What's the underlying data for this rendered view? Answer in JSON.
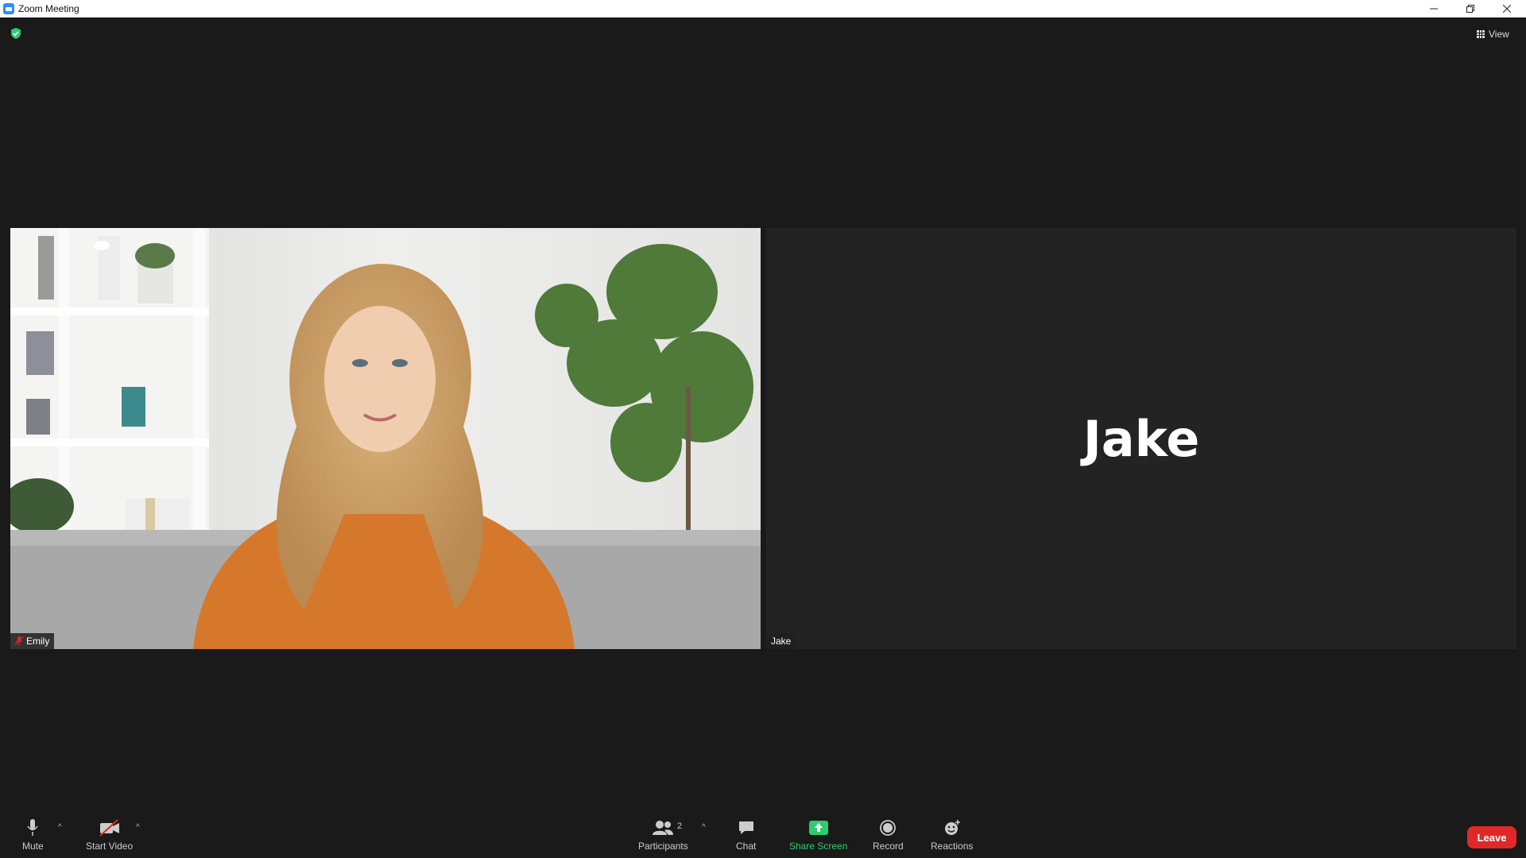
{
  "window": {
    "title": "Zoom Meeting"
  },
  "header": {
    "view_label": "View"
  },
  "participants": [
    {
      "name": "Emily",
      "muted": true,
      "video_on": true
    },
    {
      "name": "Jake",
      "muted": false,
      "video_on": false,
      "display_text": "Jake"
    }
  ],
  "toolbar": {
    "mute_label": "Mute",
    "start_video_label": "Start Video",
    "participants_label": "Participants",
    "participants_count": "2",
    "chat_label": "Chat",
    "share_label": "Share Screen",
    "record_label": "Record",
    "reactions_label": "Reactions",
    "leave_label": "Leave"
  },
  "colors": {
    "share_green": "#2ecc71",
    "leave_red": "#e02828",
    "shield_green": "#2ecc71"
  }
}
